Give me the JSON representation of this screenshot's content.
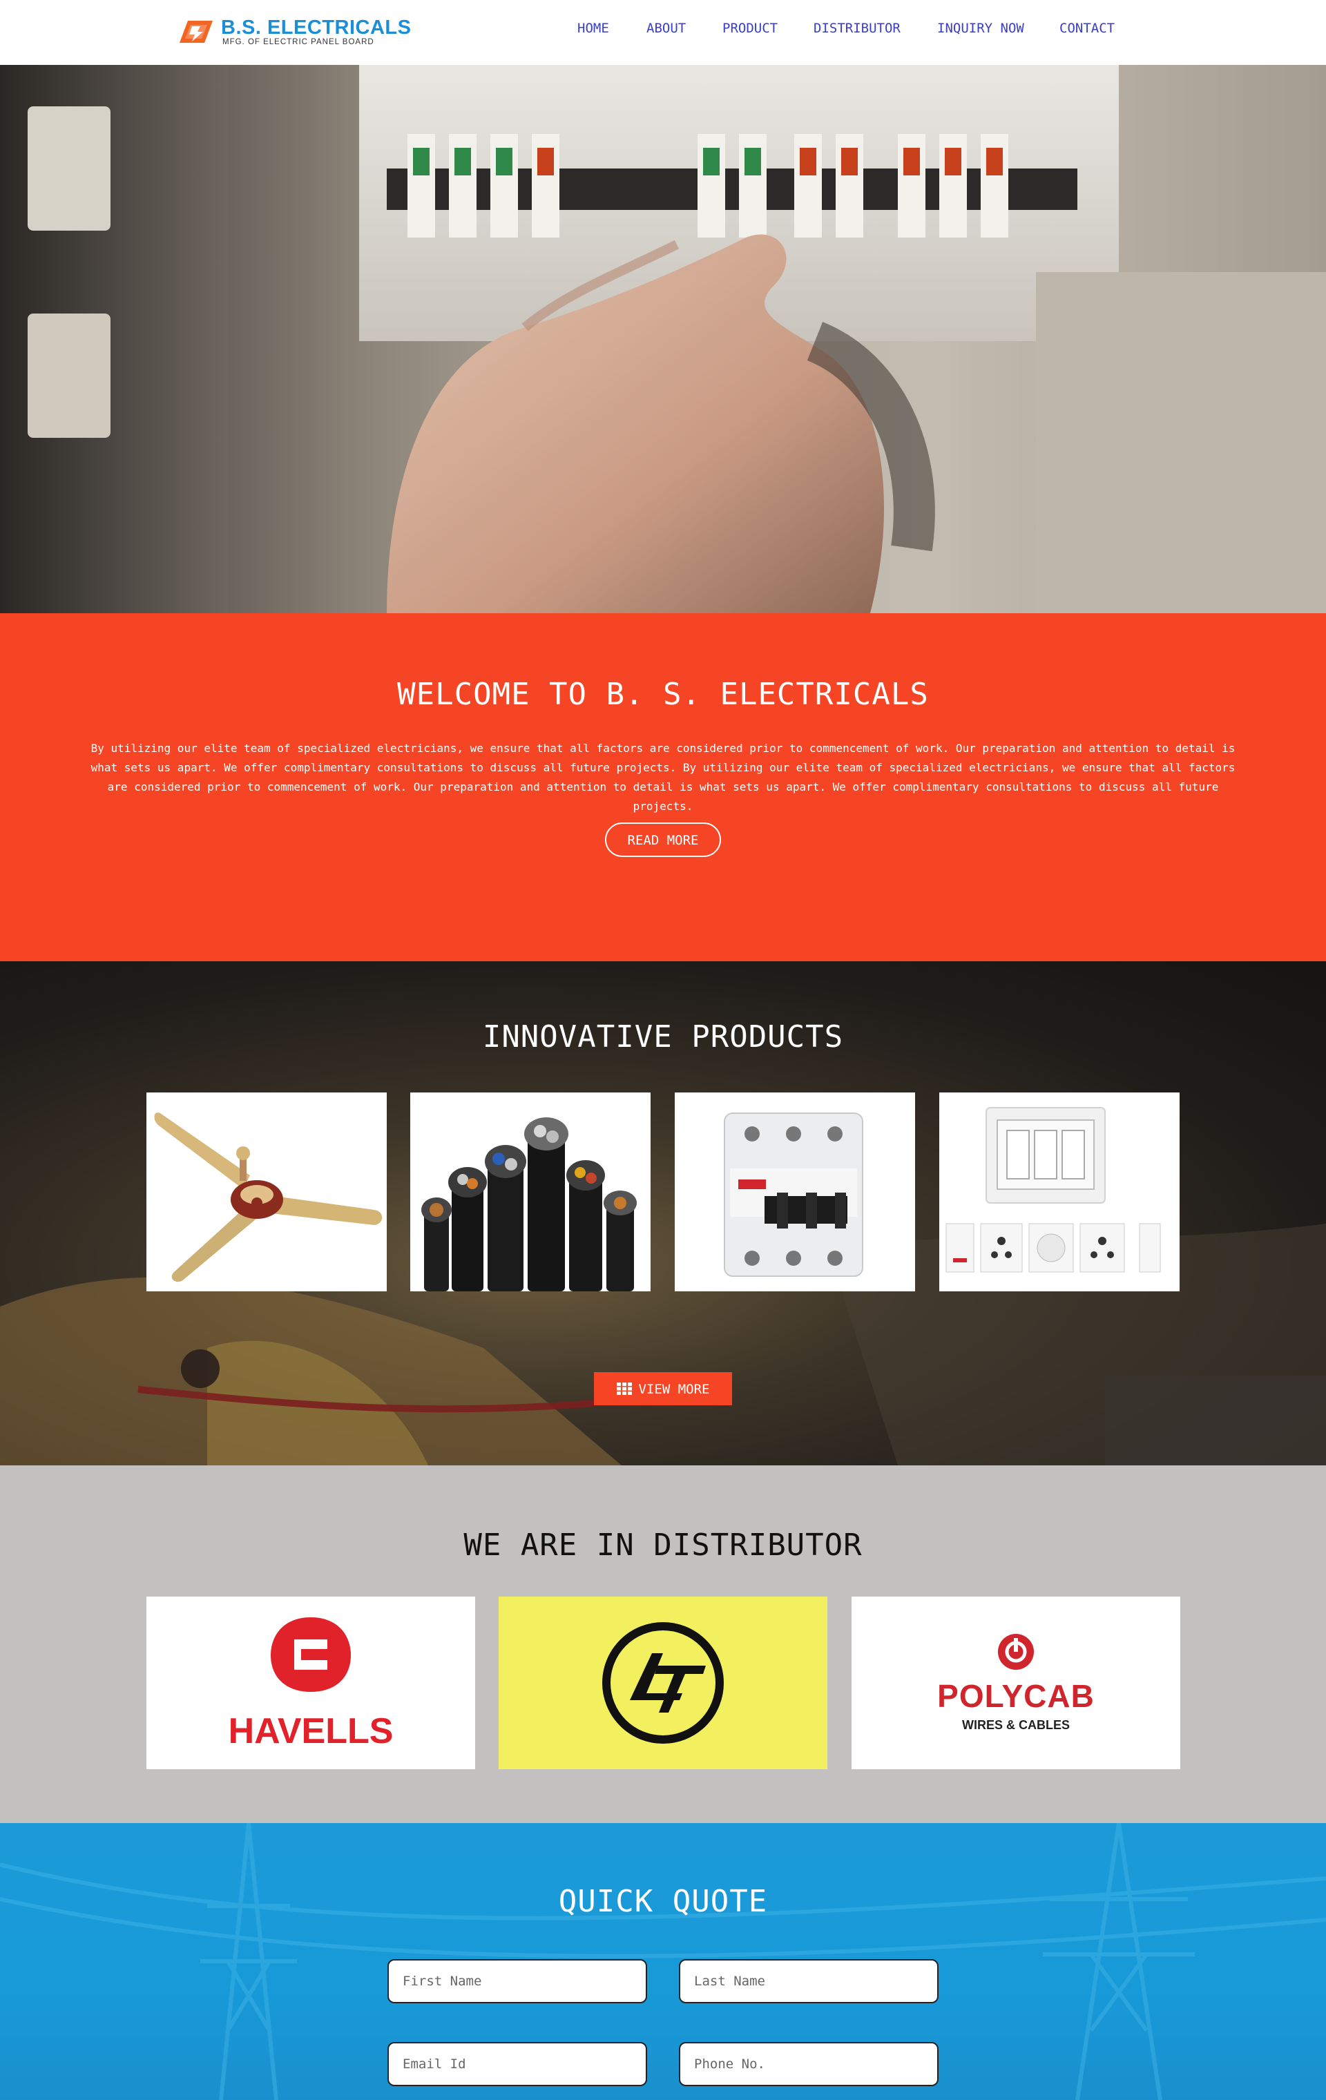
{
  "header": {
    "logo": {
      "title": "B.S. ELECTRICALS",
      "subtitle": "MFG. OF ELECTRIC PANEL BOARD"
    },
    "nav": [
      "HOME",
      "ABOUT",
      "PRODUCT",
      "DISTRIBUTOR",
      "INQUIRY NOW",
      "CONTACT"
    ]
  },
  "welcome": {
    "title": "WELCOME TO B. S. ELECTRICALS",
    "body": "By utilizing our elite team of specialized electricians, we ensure that all factors are considered prior to commencement of work. Our preparation and attention to detail is what sets us apart. We offer complimentary consultations to discuss all future projects. By utilizing our elite team of specialized electricians, we ensure that all factors are considered prior to commencement of work. Our preparation and attention to detail is what sets us apart. We offer complimentary consultations to discuss all future projects.",
    "button": "READ MORE"
  },
  "products": {
    "title": "INNOVATIVE PRODUCTS",
    "items": [
      "ceiling-fan",
      "armoured-cables",
      "mcb-breaker",
      "modular-switches"
    ],
    "button": "VIEW MORE"
  },
  "distributor": {
    "title": "WE ARE IN DISTRIBUTOR",
    "brands": [
      {
        "name": "HAVELLS",
        "bg": "#ffffff",
        "color": "#e2222a"
      },
      {
        "name": "L&T",
        "bg": "#f3f05f",
        "color": "#111111"
      },
      {
        "name": "POLYCAB",
        "tagline": "WIRES & CABLES",
        "bg": "#ffffff",
        "color": "#d0252c"
      }
    ]
  },
  "quote": {
    "title": "QUICK QUOTE",
    "fields": {
      "first_name": "First Name",
      "last_name": "Last Name",
      "email": "Email Id",
      "phone": "Phone No."
    }
  },
  "colors": {
    "accent": "#f54524",
    "nav": "#3a3fc3",
    "brand_blue": "#1b8fd6",
    "quote_bg": "#1c9ad8",
    "distributor_bg": "#c2c1c0"
  }
}
